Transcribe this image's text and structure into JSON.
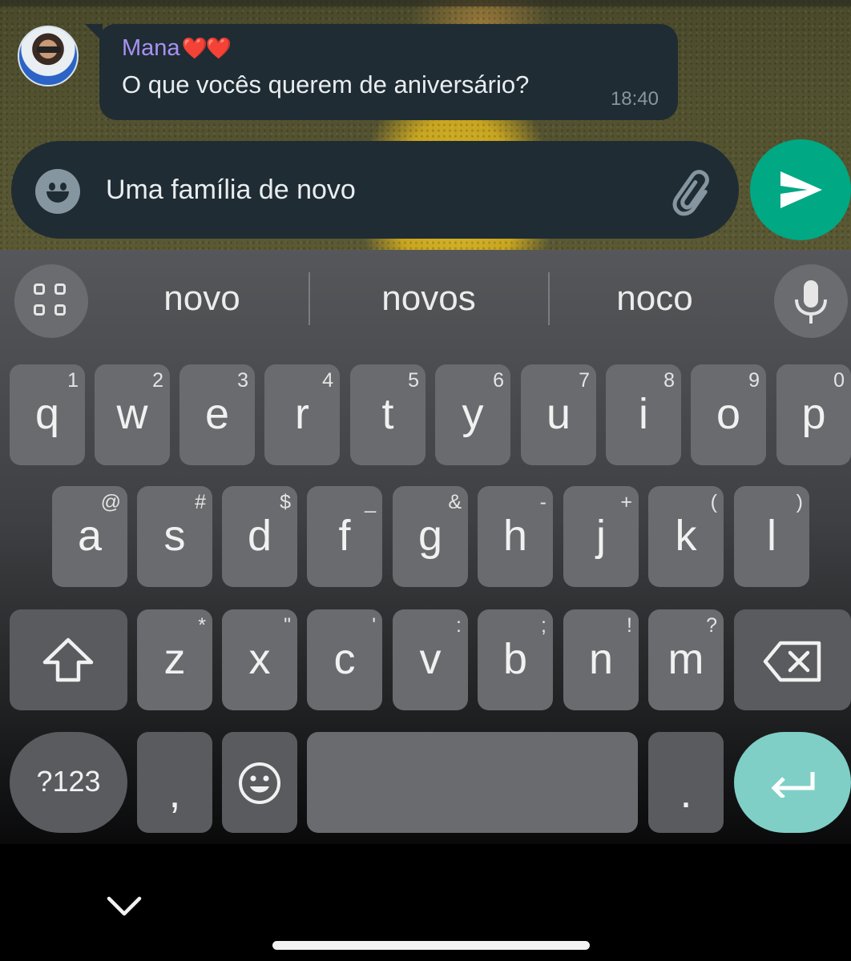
{
  "chat": {
    "sender_name": "Mana",
    "sender_hearts": "❤️❤️",
    "message_text": "O que vocês querem de aniversário?",
    "message_time": "18:40"
  },
  "composer": {
    "input_value": "Uma família de novo",
    "icons": {
      "emoji": "emoji-icon",
      "attach": "paperclip-icon",
      "send": "send-icon"
    }
  },
  "keyboard": {
    "suggestions": [
      "novo",
      "novos",
      "noco"
    ],
    "row1": [
      {
        "ch": "q",
        "hint": "1"
      },
      {
        "ch": "w",
        "hint": "2"
      },
      {
        "ch": "e",
        "hint": "3"
      },
      {
        "ch": "r",
        "hint": "4"
      },
      {
        "ch": "t",
        "hint": "5"
      },
      {
        "ch": "y",
        "hint": "6"
      },
      {
        "ch": "u",
        "hint": "7"
      },
      {
        "ch": "i",
        "hint": "8"
      },
      {
        "ch": "o",
        "hint": "9"
      },
      {
        "ch": "p",
        "hint": "0"
      }
    ],
    "row2": [
      {
        "ch": "a",
        "hint": "@"
      },
      {
        "ch": "s",
        "hint": "#"
      },
      {
        "ch": "d",
        "hint": "$"
      },
      {
        "ch": "f",
        "hint": "_"
      },
      {
        "ch": "g",
        "hint": "&"
      },
      {
        "ch": "h",
        "hint": "-"
      },
      {
        "ch": "j",
        "hint": "+"
      },
      {
        "ch": "k",
        "hint": "("
      },
      {
        "ch": "l",
        "hint": ")"
      }
    ],
    "row3": [
      {
        "ch": "z",
        "hint": "*"
      },
      {
        "ch": "x",
        "hint": "\""
      },
      {
        "ch": "c",
        "hint": "'"
      },
      {
        "ch": "v",
        "hint": ":"
      },
      {
        "ch": "b",
        "hint": ";"
      },
      {
        "ch": "n",
        "hint": "!"
      },
      {
        "ch": "m",
        "hint": "?"
      }
    ],
    "symbols_label": "?123",
    "comma": ",",
    "period": ".",
    "colors": {
      "enter_key": "#7fcfc7",
      "send_button": "#00a884",
      "sender_name": "#a991f2"
    }
  }
}
